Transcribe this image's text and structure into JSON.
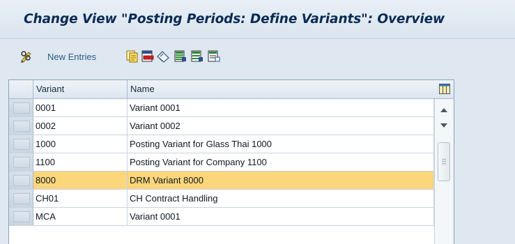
{
  "window": {
    "title": "Change View \"Posting Periods: Define Variants\": Overview"
  },
  "toolbar": {
    "new_entries_label": "New Entries",
    "icons": [
      "change-display-icon",
      "copy-icon",
      "delete-icon",
      "undo-change-icon",
      "select-all-icon",
      "select-block-icon",
      "deselect-all-icon"
    ]
  },
  "table": {
    "columns": [
      "Variant",
      "Name"
    ],
    "rows": [
      {
        "variant": "0001",
        "name": "Variant 0001",
        "selected": false
      },
      {
        "variant": "0002",
        "name": "Variant 0002",
        "selected": false
      },
      {
        "variant": "1000",
        "name": "Posting Variant for Glass Thai 1000",
        "selected": false
      },
      {
        "variant": "1100",
        "name": "Posting Variant for Company 1100",
        "selected": false
      },
      {
        "variant": "8000",
        "name": "DRM Variant 8000",
        "selected": true
      },
      {
        "variant": "CH01",
        "name": "CH Contract Handling",
        "selected": false
      },
      {
        "variant": "MCA",
        "name": "Variant 0001",
        "selected": false
      }
    ]
  },
  "colors": {
    "background": "#dfe8f1",
    "title_text": "#0a2b54",
    "selected_row": "#fbd67b",
    "link_text": "#2d5a87"
  }
}
